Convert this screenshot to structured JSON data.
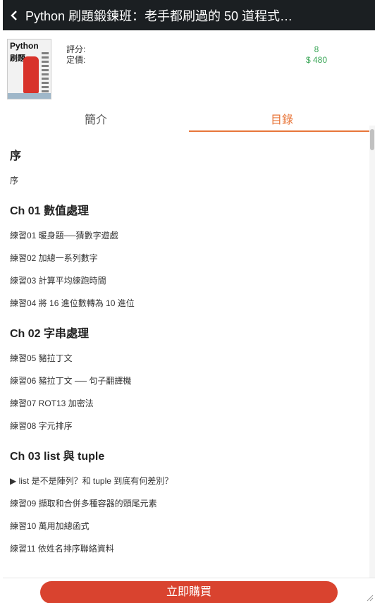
{
  "header": {
    "title": "Python 刷題鍛鍊班：老手都刷過的 50 道程式…"
  },
  "book": {
    "cover_title": "Python",
    "cover_subtitle": "刷題",
    "rating_label": "評分:",
    "price_label": "定價:",
    "rating_value": "8",
    "price_value": "$ 480"
  },
  "tabs": [
    {
      "label": "簡介",
      "active": false
    },
    {
      "label": "目錄",
      "active": true
    }
  ],
  "toc": {
    "sections": [
      {
        "title": "序",
        "items": [
          "序"
        ]
      },
      {
        "title": "Ch 01 數值處理",
        "items": [
          "練習01 暖身題──猜數字遊戲",
          "練習02 加總一系列數字",
          "練習03 計算平均練跑時間",
          "練習04 將 16 進位數轉為 10 進位"
        ]
      },
      {
        "title": "Ch 02 字串處理",
        "items": [
          "練習05 豬拉丁文",
          "練習06 豬拉丁文 ── 句子翻譯機",
          "練習07 ROT13 加密法",
          "練習08 字元排序"
        ]
      },
      {
        "title": "Ch 03 list 與 tuple",
        "items": [
          "▶ list 是不是陣列？和 tuple 到底有何差別？",
          "練習09 擷取和合併多種容器的頭尾元素",
          "練習10 萬用加總函式",
          "練習11 依姓名排序聯絡資料"
        ]
      }
    ]
  },
  "footer": {
    "buy_label": "立即購買"
  },
  "colors": {
    "header_bg": "#1b1f22",
    "accent": "#e8763a",
    "value_green": "#3aa657",
    "buy_red": "#d9432f"
  }
}
